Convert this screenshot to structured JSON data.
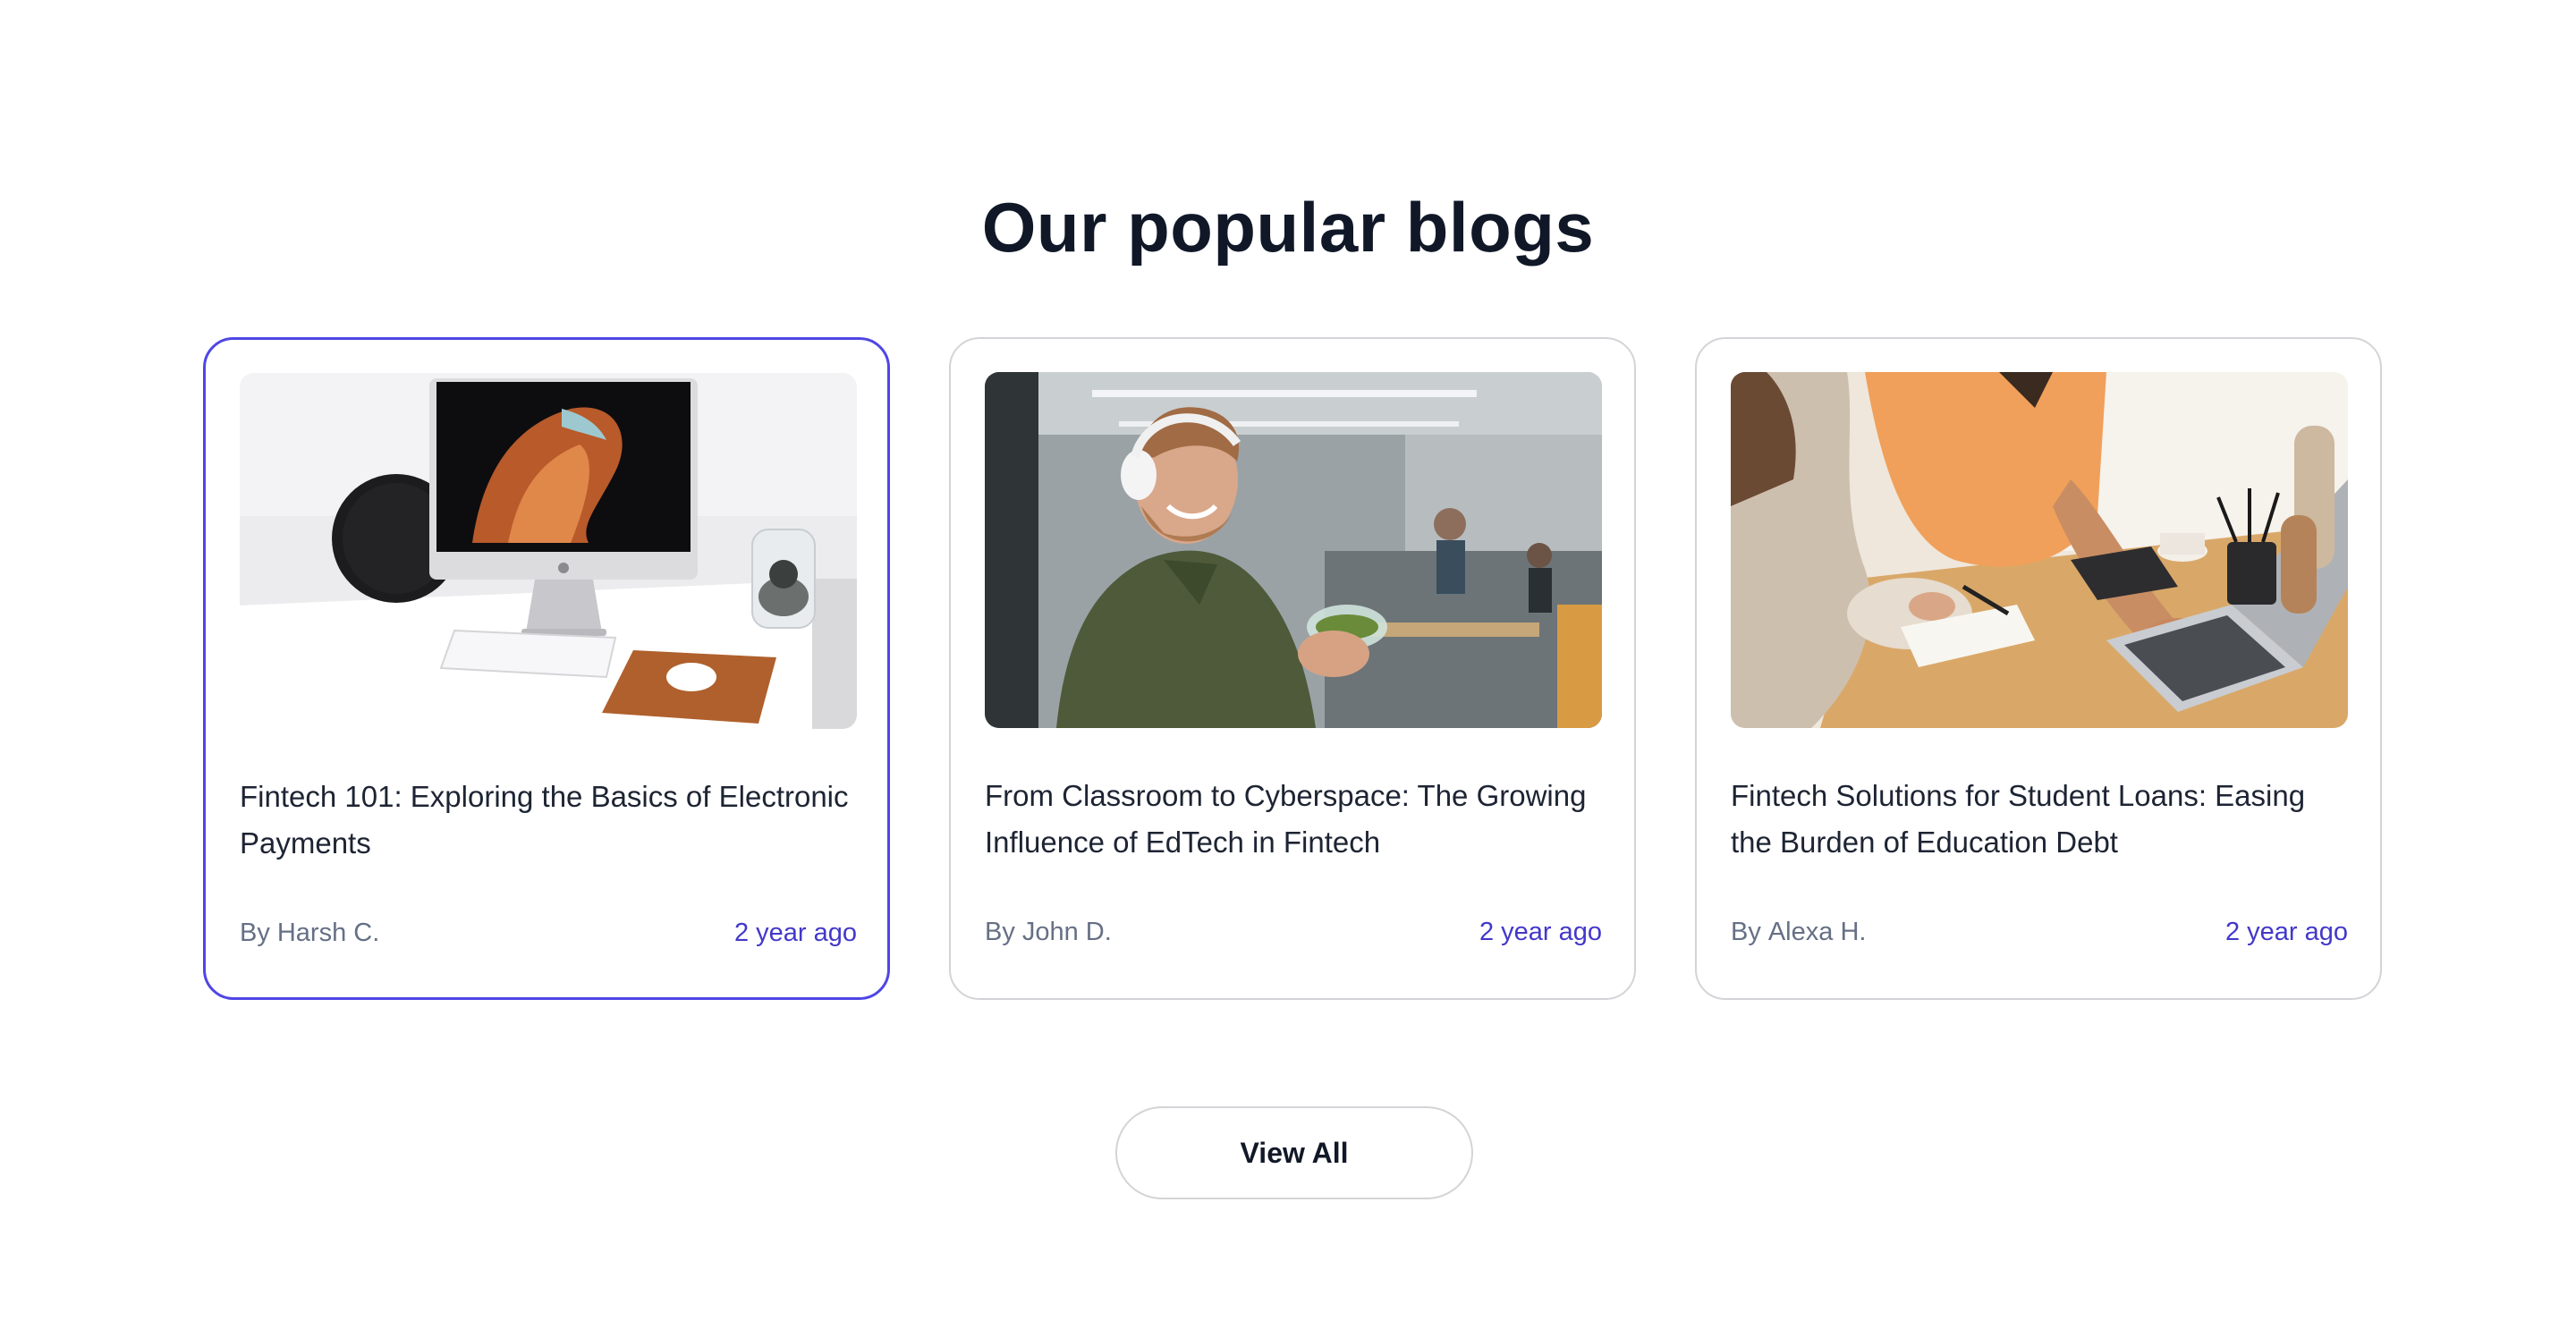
{
  "section": {
    "title": "Our popular blogs"
  },
  "blogs": [
    {
      "title": "Fintech 101: Exploring the Basics of Electronic Payments",
      "by_label": "By",
      "author": "Harsh C.",
      "date": "2 year ago",
      "image": "desk-computer-photo",
      "active": true
    },
    {
      "title": "From Classroom to Cyberspace: The Growing Influence of EdTech in Fintech",
      "by_label": "By",
      "author": "John D.",
      "date": "2 year ago",
      "image": "office-man-headphones-photo",
      "active": false
    },
    {
      "title": "Fintech Solutions for Student Loans: Easing the Burden of Education Debt",
      "by_label": "By",
      "author": "Alexa H.",
      "date": "2 year ago",
      "image": "students-laptop-photo",
      "active": false
    }
  ],
  "actions": {
    "view_all_label": "View All"
  },
  "colors": {
    "accent": "#4f46e5",
    "date_text": "#4338ca",
    "title_text": "#101828",
    "muted_text": "#667085",
    "card_border": "#d4d4d8"
  }
}
